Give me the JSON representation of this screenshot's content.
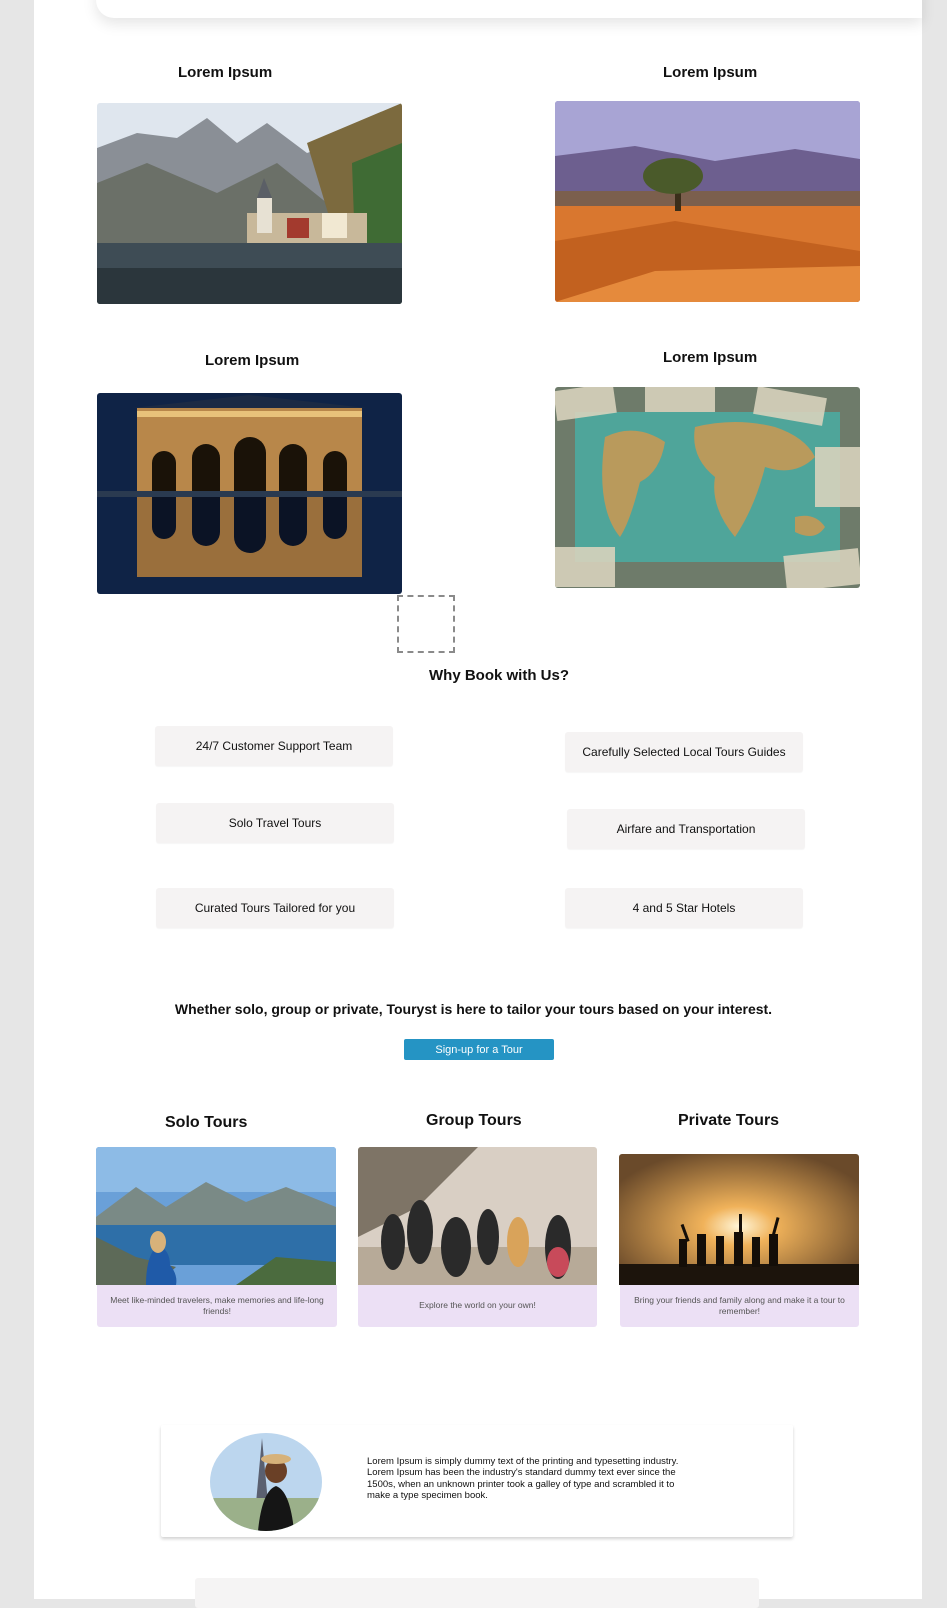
{
  "destinations": [
    {
      "title": "Lorem Ipsum",
      "image": "alpine-lake-village"
    },
    {
      "title": "Lorem Ipsum",
      "image": "desert-dunes-tree"
    },
    {
      "title": "Lorem Ipsum",
      "image": "illuminated-gate-night"
    },
    {
      "title": "Lorem Ipsum",
      "image": "world-map-currency"
    }
  ],
  "why": {
    "heading": "Why Book with Us?",
    "items": [
      "24/7  Customer Support Team",
      "Carefully Selected Local Tours Guides",
      "Solo Travel Tours",
      "Airfare and Transportation",
      "Curated Tours Tailored for you",
      "4 and 5 Star Hotels"
    ]
  },
  "tagline": "Whether solo, group or private, Touryst is here to tailor your tours based on your interest.",
  "cta_label": "Sign-up for a Tour",
  "tours": [
    {
      "title": "Solo Tours",
      "caption": "Meet like-minded travelers, make memories and life-long friends!",
      "image": "woman-overlooking-fjord"
    },
    {
      "title": "Group Tours",
      "caption": "Explore the world on your own!",
      "image": "group-hiking"
    },
    {
      "title": "Private Tours",
      "caption": "Bring your friends and family along and make it a tour to remember!",
      "image": "silhouettes-sunset"
    }
  ],
  "testimonial": {
    "text": "Lorem Ipsum is simply dummy text of the printing and typesetting industry. Lorem Ipsum has been the industry's standard dummy text ever since the 1500s, when an unknown printer took a galley of type and scrambled it to make a type specimen book.",
    "avatar": "woman-eiffel-tower"
  },
  "colors": {
    "accent": "#2594c4",
    "card_caption_bg": "#ece0f5",
    "pill_bg": "#f5f3f3"
  }
}
